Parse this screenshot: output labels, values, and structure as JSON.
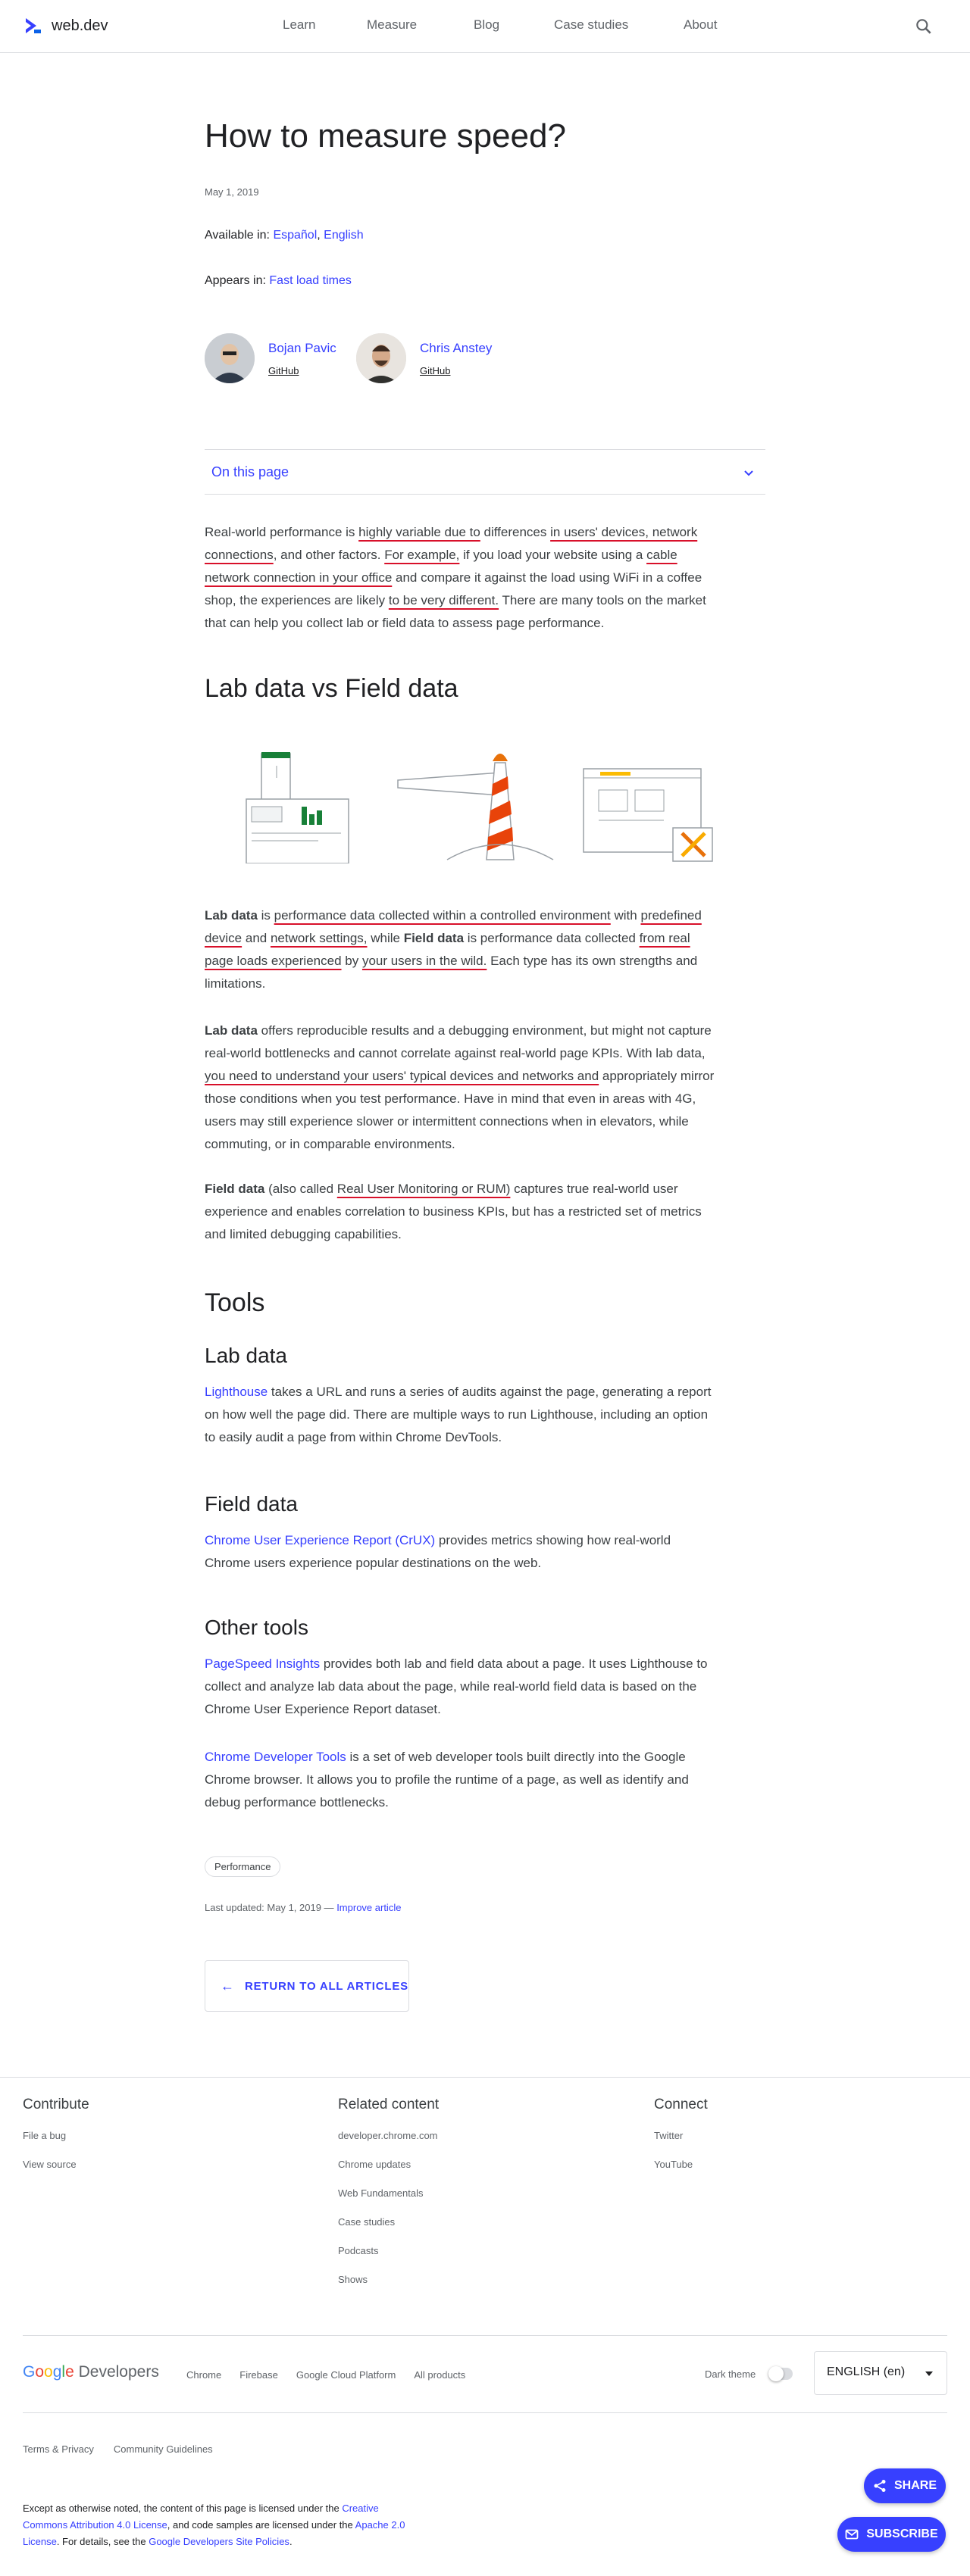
{
  "header": {
    "logo_text": "web.dev",
    "nav": [
      "Learn",
      "Measure",
      "Blog",
      "Case studies",
      "About"
    ]
  },
  "article": {
    "title": "How to measure speed?",
    "date": "May 1, 2019",
    "available_prefix": "Available in:",
    "available_langs": [
      "Español",
      "English"
    ],
    "appears_prefix": "Appears in:",
    "appears_link": "Fast load times",
    "authors": [
      {
        "name": "Bojan Pavic",
        "link": "GitHub"
      },
      {
        "name": "Chris Anstey",
        "link": "GitHub"
      }
    ],
    "toc_label": "On this page",
    "intro": {
      "t1": "Real-world performance is ",
      "u1": "highly variable due to",
      "t2": " differences ",
      "u2": "in users' devices, network connections",
      "t3": ", and other factors. ",
      "u3": "For example,",
      "t4": " if you load your website using a ",
      "u4": "cable network connection in your office",
      "t5": " and compare it against the load using WiFi in a coffee shop, the experiences are likely ",
      "u5": "to be very different.",
      "t6": " There are many tools on the market that can help you collect lab or field data to assess page performance."
    },
    "h2_lab_field": "Lab data vs Field data",
    "lab_def": {
      "b1": "Lab data",
      "t1": " is ",
      "u1": "performance data collected within a controlled environment",
      "t2": " with ",
      "u2": "predefined device",
      "t3": " and ",
      "u3": "network settings,",
      "t4": " while ",
      "b2": "Field data",
      "t5": " is performance data collected ",
      "u4": "from real page loads experienced",
      "t6": " by ",
      "u5": "your users in the wild.",
      "t7": " Each type has its own strengths and limitations."
    },
    "lab_para": {
      "b1": "Lab data",
      "t1": " offers reproducible results and a debugging environment, but might not capture real-world bottlenecks and cannot correlate against real-world page KPIs. With lab data, ",
      "u1": "you need to understand your users' typical devices and networks and",
      "t2": " appropriately mirror those conditions when you test performance. Have in mind that even in areas with 4G, users may still experience slower or intermittent connections when in elevators, while commuting, or in comparable environments."
    },
    "field_para": {
      "b1": "Field data",
      "t1": " (also called ",
      "u1": "Real User Monitoring or RUM)",
      "t2": " captures true real-world user experience and enables correlation to business KPIs, but has a restricted set of metrics and limited debugging capabilities."
    },
    "h2_tools": "Tools",
    "h3_lab": "Lab data",
    "lighthouse": {
      "link": "Lighthouse",
      "text": " takes a URL and runs a series of audits against the page, generating a report on how well the page did. There are multiple ways to run Lighthouse, including an option to easily audit a page from within Chrome DevTools."
    },
    "h3_field": "Field data",
    "crux": {
      "link": "Chrome User Experience Report (CrUX)",
      "text": " provides metrics showing how real-world Chrome users experience popular destinations on the web."
    },
    "h3_other": "Other tools",
    "psi": {
      "link": "PageSpeed Insights",
      "text": " provides both lab and field data about a page. It uses Lighthouse to collect and analyze lab data about the page, while real-world field data is based on the Chrome User Experience Report dataset."
    },
    "devtools": {
      "link": "Chrome Developer Tools",
      "text": " is a set of web developer tools built directly into the Google Chrome browser. It allows you to profile the runtime of a page, as well as identify and debug performance bottlenecks."
    },
    "tag": "Performance",
    "last_updated": "Last updated: May 1, 2019 —",
    "improve_link": "Improve article",
    "return_label": "RETURN TO ALL ARTICLES"
  },
  "footer": {
    "contribute": {
      "title": "Contribute",
      "links": [
        "File a bug",
        "View source"
      ]
    },
    "related": {
      "title": "Related content",
      "links": [
        "developer.chrome.com",
        "Chrome updates",
        "Web Fundamentals",
        "Case studies",
        "Podcasts",
        "Shows"
      ]
    },
    "connect": {
      "title": "Connect",
      "links": [
        "Twitter",
        "YouTube"
      ]
    },
    "google_word": "Google",
    "developers_word": "Developers",
    "product_links": [
      "Chrome",
      "Firebase",
      "Google Cloud Platform",
      "All products"
    ],
    "dark_theme": "Dark theme",
    "language": "ENGLISH (en)",
    "legal_links": [
      "Terms & Privacy",
      "Community Guidelines"
    ],
    "license": {
      "t1": "Except as otherwise noted, the content of this page is licensed under the ",
      "l1": "Creative Commons Attribution 4.0 License",
      "t2": ", and code samples are licensed under the ",
      "l2": "Apache 2.0 License",
      "t3": ". For details, see the ",
      "l3": "Google Developers Site Policies",
      "t4": "."
    },
    "share_label": "SHARE",
    "subscribe_label": "SUBSCRIBE"
  },
  "colors": {
    "accent": "#3740ff",
    "ink": "#d8102a",
    "text": "#3c4043"
  }
}
